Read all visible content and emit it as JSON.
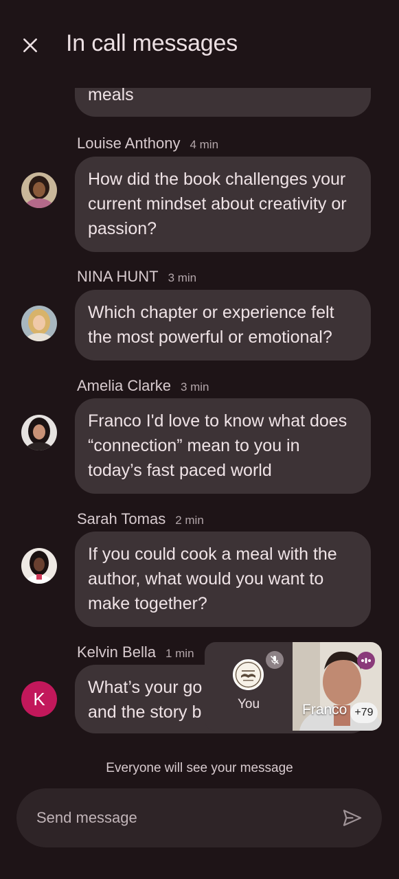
{
  "header": {
    "title": "In call messages",
    "close_icon": "close-icon"
  },
  "messages": [
    {
      "sender": "",
      "time": "",
      "text": "meals",
      "avatar": ""
    },
    {
      "sender": "Louise Anthony",
      "time": "4 min",
      "text": "How did the book challenges your current mindset about creativity or passion?",
      "avatar": "photo"
    },
    {
      "sender": "NINA HUNT",
      "time": "3 min",
      "text": "Which chapter or experience felt the most powerful or emotional?",
      "avatar": "photo"
    },
    {
      "sender": "Amelia Clarke",
      "time": "3 min",
      "text": "Franco I'd love to know what does “connection” mean to you in today’s fast paced world",
      "avatar": "photo"
    },
    {
      "sender": "Sarah Tomas",
      "time": "2 min",
      "text": "If you could cook a meal with the author, what would you want to make together?",
      "avatar": "photo"
    },
    {
      "sender": "Kelvin Bella",
      "time": "1 min",
      "text": "What’s your go and the story b",
      "avatar_letter": "K",
      "avatar_color": "#c2185b"
    }
  ],
  "pip": {
    "self_label": "You",
    "remote_label": "Franco",
    "participant_count": "+79",
    "mic_icon": "mic-off-icon",
    "speaking_icon": "speaking-icon"
  },
  "footer": {
    "note": "Everyone will see your message",
    "composer_placeholder": "Send message",
    "send_icon": "send-icon"
  },
  "colors": {
    "background": "#1e1417",
    "bubble": "#3d3336",
    "composer": "#2e2427",
    "avatar_k": "#c2185b",
    "speaking": "#8a3a7a"
  }
}
